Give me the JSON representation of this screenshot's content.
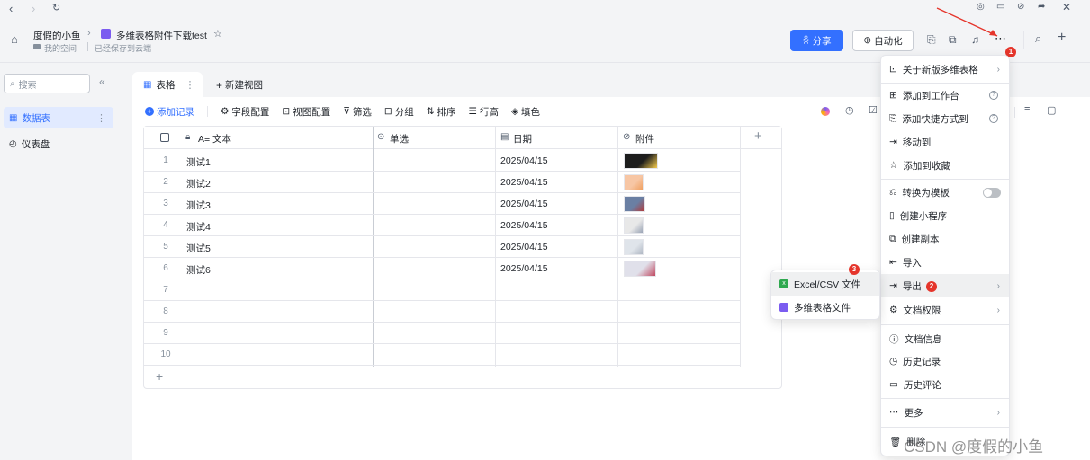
{
  "header": {
    "breadcrumb_user": "度假的小鱼",
    "doc_title": "多维表格附件下载test",
    "space": "我的空间",
    "saved": "已经保存到云端",
    "share": "分享",
    "automation": "自动化"
  },
  "sidebar": {
    "search_placeholder": "搜索",
    "items": [
      {
        "label": "数据表"
      },
      {
        "label": "仪表盘"
      }
    ]
  },
  "tabs": {
    "table_tab": "表格",
    "new_view": "新建视图"
  },
  "toolbar": {
    "add_record": "添加记录",
    "field_config": "字段配置",
    "view_config": "视图配置",
    "filter": "筛选",
    "group": "分组",
    "sort": "排序",
    "row_height": "行高",
    "fill": "填色"
  },
  "table": {
    "columns": [
      "A≡ 文本",
      "单选",
      "日期",
      "附件"
    ],
    "rows": [
      {
        "n": "1",
        "text": "测试1",
        "date": "2025/04/15"
      },
      {
        "n": "2",
        "text": "测试2",
        "date": "2025/04/15"
      },
      {
        "n": "3",
        "text": "测试3",
        "date": "2025/04/15"
      },
      {
        "n": "4",
        "text": "测试4",
        "date": "2025/04/15"
      },
      {
        "n": "5",
        "text": "测试5",
        "date": "2025/04/15"
      },
      {
        "n": "6",
        "text": "测试6",
        "date": "2025/04/15"
      },
      {
        "n": "7",
        "text": "",
        "date": ""
      },
      {
        "n": "8",
        "text": "",
        "date": ""
      },
      {
        "n": "9",
        "text": "",
        "date": ""
      },
      {
        "n": "10",
        "text": "",
        "date": ""
      }
    ]
  },
  "more_menu": {
    "items": [
      "关于新版多维表格",
      "添加到工作台",
      "添加快捷方式到",
      "移动到",
      "添加到收藏",
      "转换为模板",
      "创建小程序",
      "创建副本",
      "导入",
      "导出",
      "文档权限",
      "文档信息",
      "历史记录",
      "历史评论",
      "更多",
      "删除"
    ]
  },
  "export_menu": {
    "items": [
      "Excel/CSV 文件",
      "多维表格文件"
    ]
  },
  "badges": [
    "1",
    "2",
    "3"
  ],
  "watermark": "CSDN @度假的小鱼",
  "colors": {
    "accent": "#3370ff",
    "badge": "#e5352b",
    "excel": "#2fa84f",
    "bitable": "#7b5cf0"
  }
}
